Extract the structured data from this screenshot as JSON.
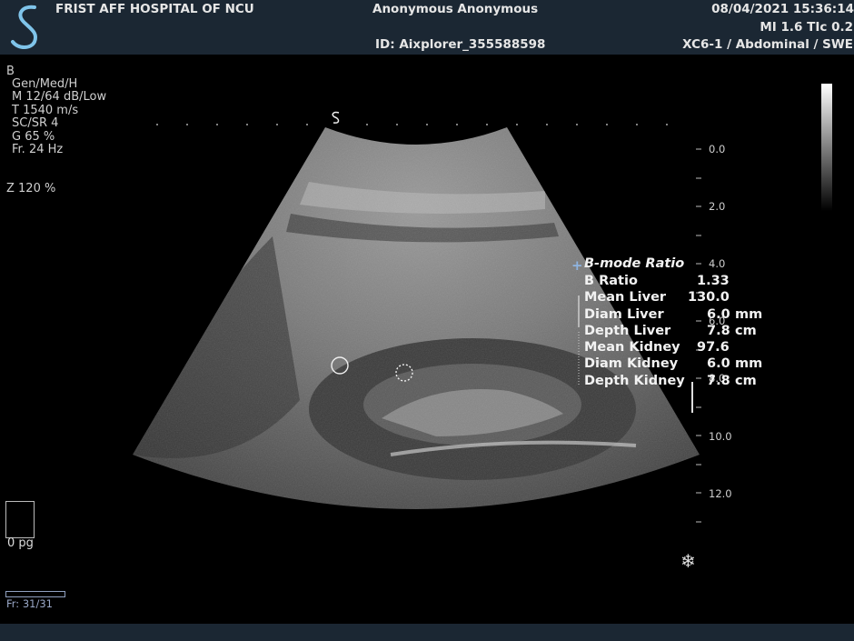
{
  "header": {
    "hospital": "FRIST AFF HOSPITAL OF NCU",
    "patient": "Anonymous Anonymous",
    "patient_id": "ID: Aixplorer_355588598",
    "datetime": "08/04/2021 15:36:14",
    "mi_tic": "MI 1.6  TIc  0.2",
    "probe_preset": "XC6-1 / Abdominal / SWE"
  },
  "image_params": {
    "mode": "B",
    "lines": [
      "Gen/Med/H",
      "M 12/64 dB/Low",
      "T 1540 m/s",
      "SC/SR 4",
      "G 65 %",
      "Fr. 24 Hz"
    ],
    "zoom": "Z  120  %"
  },
  "depth_scale": [
    "0.0",
    "2.0",
    "4.0",
    "6.0",
    "8.0",
    "10.0",
    "12.0"
  ],
  "measurement": {
    "title": "B-mode Ratio",
    "rows": [
      {
        "label": "B Ratio",
        "value": "1.33",
        "unit": ""
      },
      {
        "label": "Mean Liver",
        "value": "130.0",
        "unit": ""
      },
      {
        "label": "Diam Liver",
        "value": "6.0",
        "unit": "mm"
      },
      {
        "label": "Depth Liver",
        "value": "7.8",
        "unit": "cm"
      },
      {
        "label": "Mean Kidney",
        "value": "97.6",
        "unit": ""
      },
      {
        "label": "Diam Kidney",
        "value": "6.0",
        "unit": "mm"
      },
      {
        "label": "Depth Kidney",
        "value": "7.8",
        "unit": "cm"
      }
    ]
  },
  "page_label": "0 pg",
  "frame_label": "Fr: 31/31",
  "icons": {
    "logo": "supersonic-logo-icon",
    "freeze": "snowflake-icon",
    "orientation": "probe-orientation-icon"
  }
}
